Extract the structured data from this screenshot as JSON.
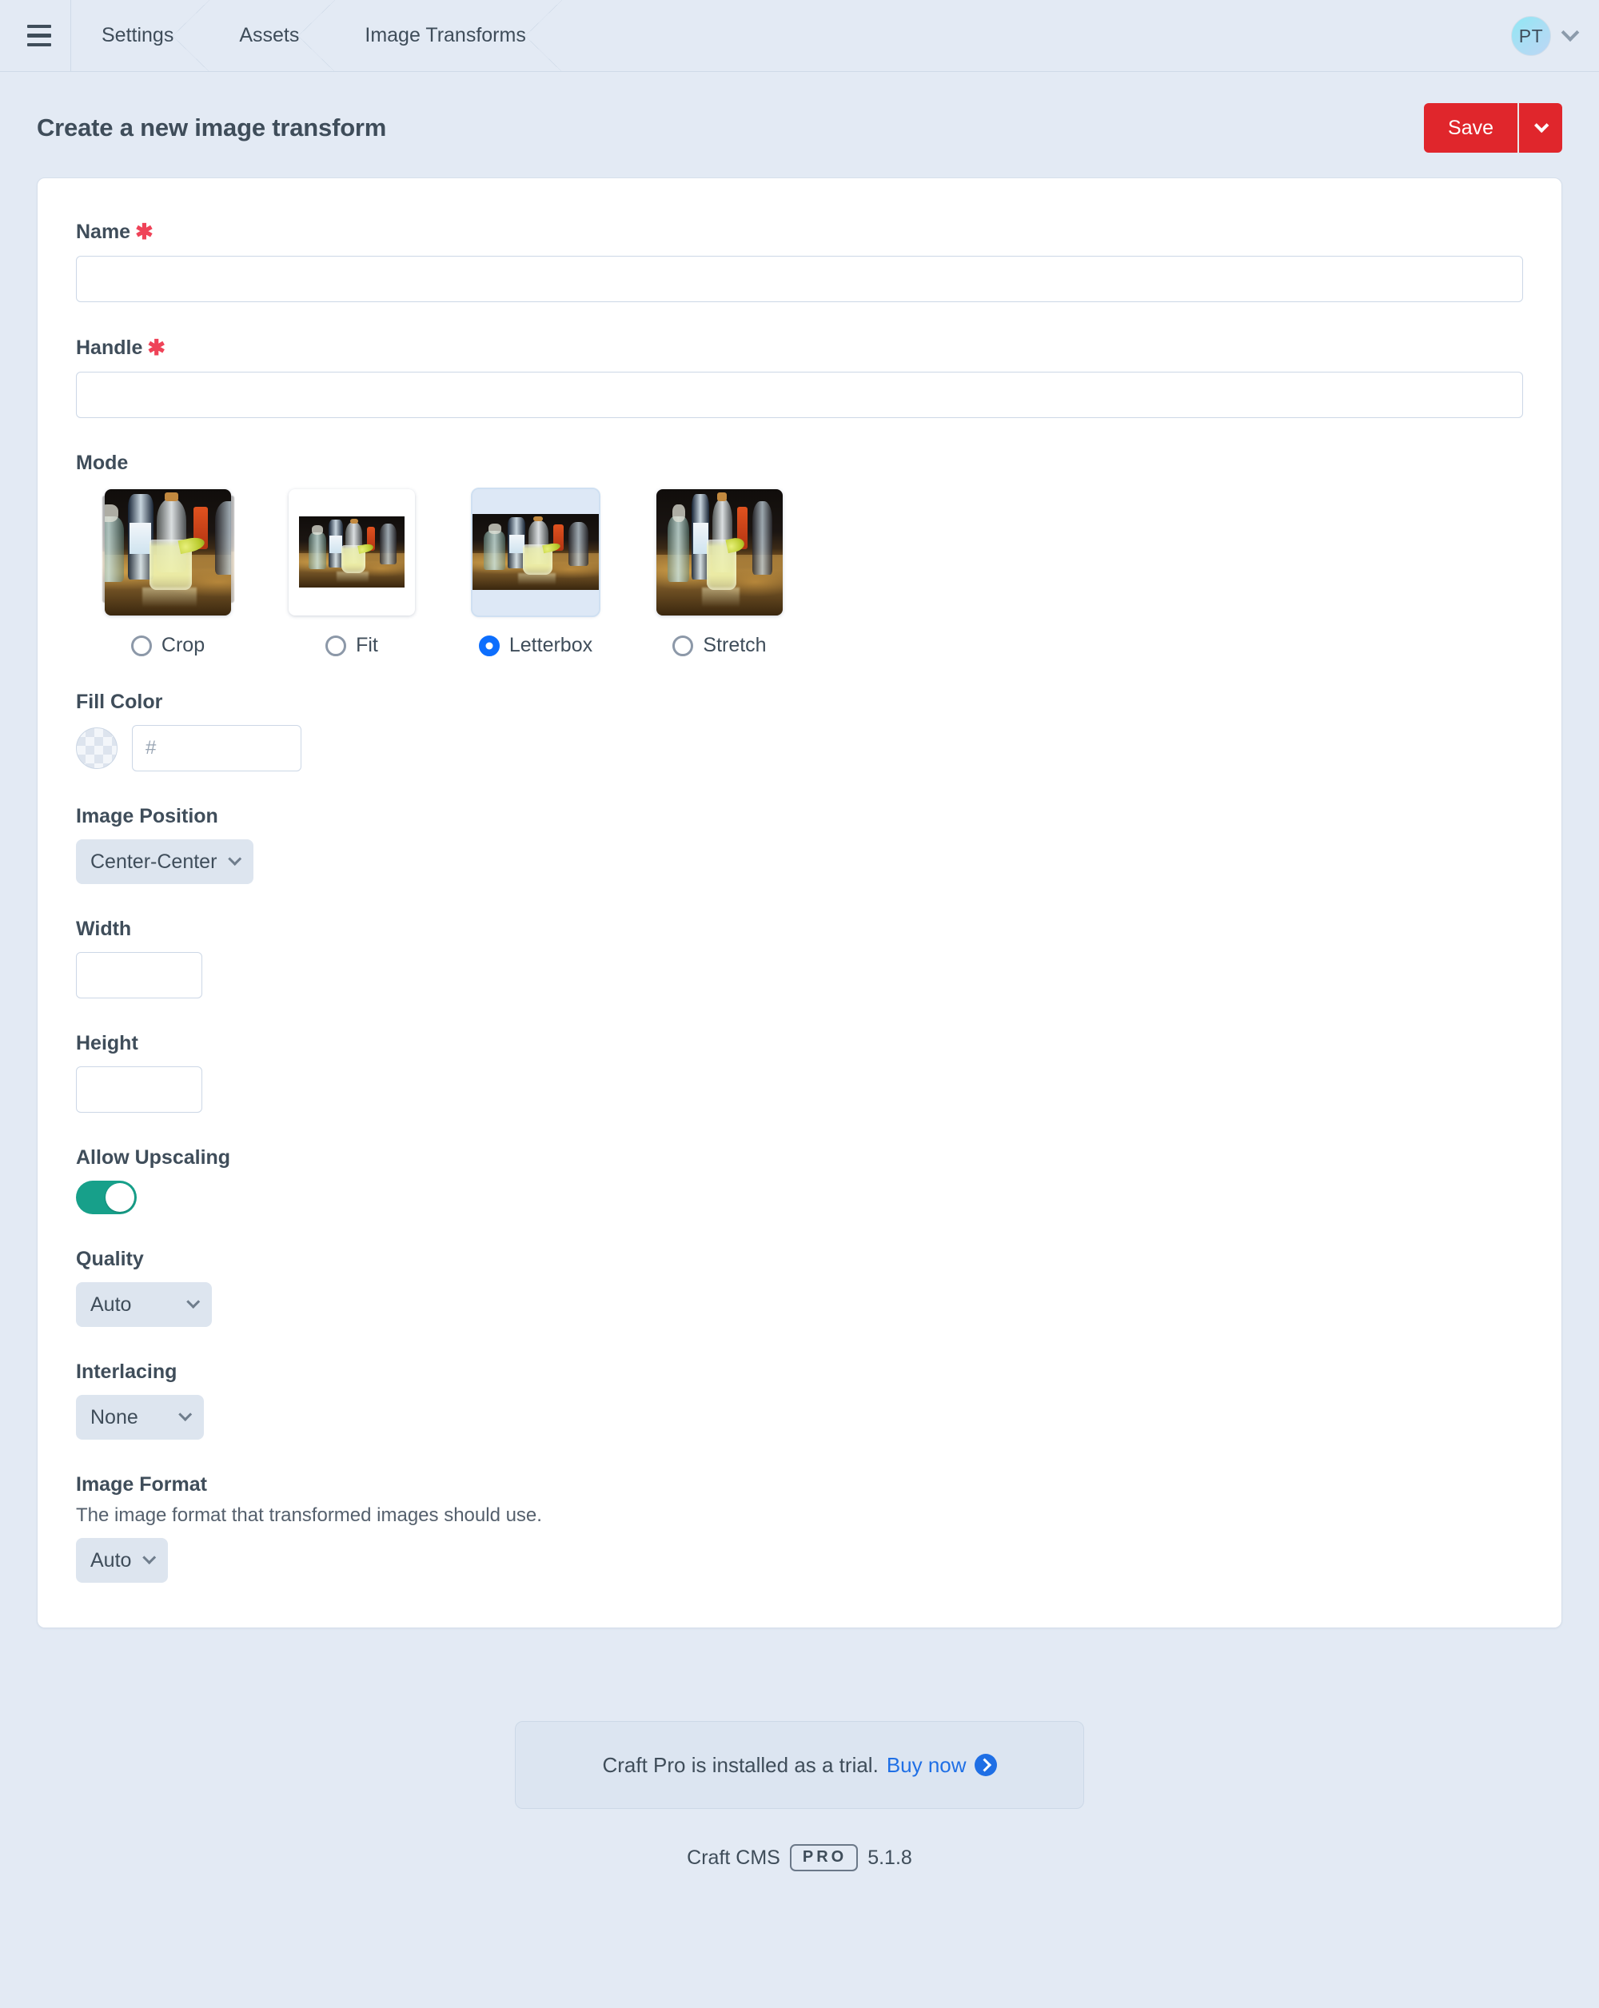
{
  "globalbar": {
    "menu_icon": "hamburger-icon",
    "breadcrumbs": [
      {
        "label": "Settings"
      },
      {
        "label": "Assets"
      },
      {
        "label": "Image Transforms"
      }
    ],
    "account": {
      "initials": "PT",
      "chevron_icon": "chevron-down-icon"
    }
  },
  "header": {
    "title": "Create a new image transform",
    "save_label": "Save",
    "save_menu_icon": "chevron-down-icon",
    "save_color": "#e0262c"
  },
  "form": {
    "name": {
      "label": "Name",
      "required": true,
      "value": "",
      "placeholder": ""
    },
    "handle": {
      "label": "Handle",
      "required": true,
      "value": "",
      "placeholder": ""
    },
    "mode": {
      "label": "Mode",
      "selected": "Letterbox",
      "options": [
        {
          "label": "Crop",
          "selected": false
        },
        {
          "label": "Fit",
          "selected": false
        },
        {
          "label": "Letterbox",
          "selected": true
        },
        {
          "label": "Stretch",
          "selected": false
        }
      ]
    },
    "fill_color": {
      "label": "Fill Color",
      "swatch": "transparent-checkerboard",
      "value": "",
      "prefix": "#"
    },
    "image_position": {
      "label": "Image Position",
      "value": "Center-Center"
    },
    "width": {
      "label": "Width",
      "value": ""
    },
    "height": {
      "label": "Height",
      "value": ""
    },
    "allow_upscaling": {
      "label": "Allow Upscaling",
      "enabled": true,
      "color": "#17a08a"
    },
    "quality": {
      "label": "Quality",
      "value": "Auto"
    },
    "interlacing": {
      "label": "Interlacing",
      "value": "None"
    },
    "image_format": {
      "label": "Image Format",
      "instructions": "The image format that transformed images should use.",
      "value": "Auto"
    }
  },
  "footer": {
    "trial_text": "Craft Pro is installed as a trial.",
    "buy_label": "Buy now",
    "buy_icon": "arrow-right-circle-icon",
    "product": "Craft CMS",
    "edition": "PRO",
    "version": "5.1.8"
  }
}
